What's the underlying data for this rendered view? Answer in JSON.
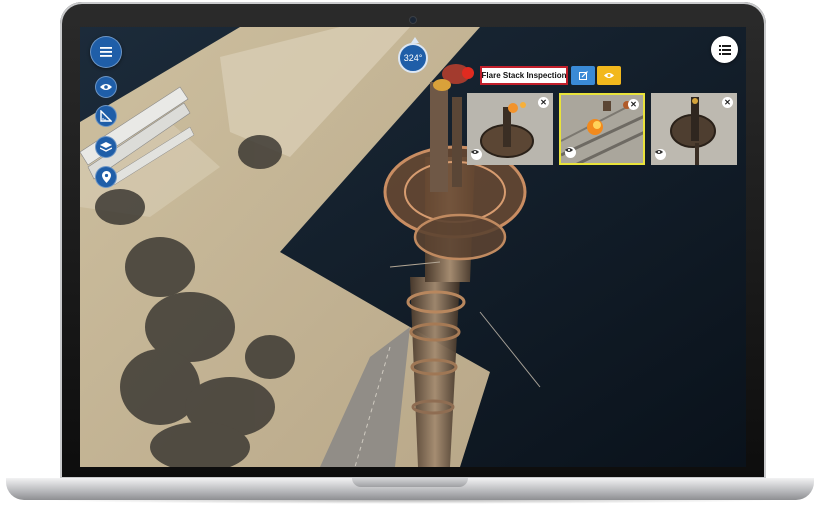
{
  "compass": {
    "heading": "324°"
  },
  "inspection": {
    "title": "Flare Stack Inspection"
  },
  "icons": {
    "menu": "menu-icon",
    "eye": "eye-icon",
    "measure": "ruler-triangle-icon",
    "layers": "layers-icon",
    "pin": "map-pin-icon",
    "list": "list-icon",
    "edit": "edit-icon",
    "view": "eye-icon",
    "close": "close-icon"
  },
  "thumbnails": [
    {
      "close_label": "✕",
      "selected": false
    },
    {
      "close_label": "✕",
      "selected": true
    },
    {
      "close_label": "✕",
      "selected": false
    }
  ],
  "colors": {
    "primary": "#1f5ea8",
    "edit": "#3a8ad6",
    "view": "#f2b81d",
    "highlight": "#c21f2b",
    "selected_border": "#e9e33b"
  }
}
